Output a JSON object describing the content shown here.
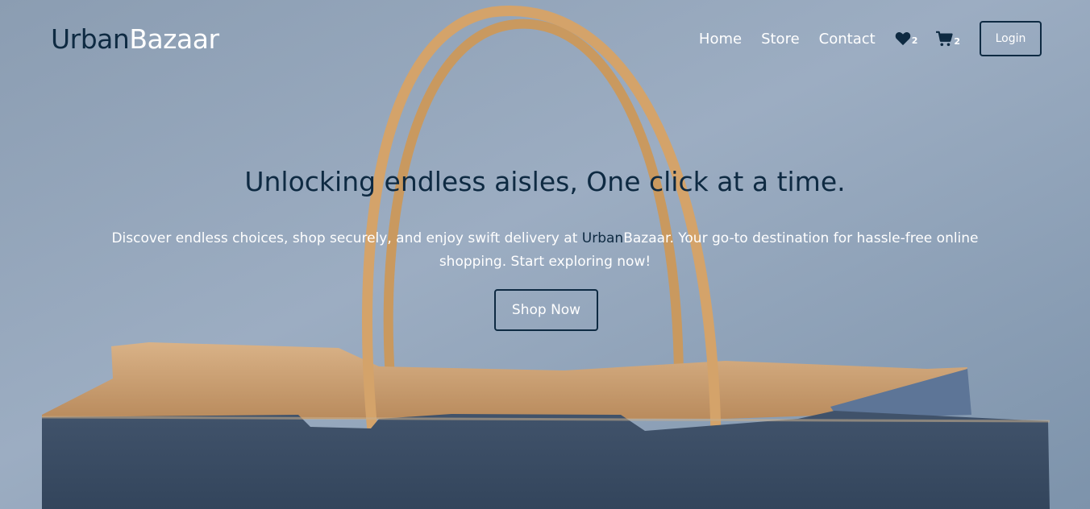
{
  "nav": {
    "brand_part1": "Urban",
    "brand_part2": "Bazaar",
    "links": [
      "Home",
      "Store",
      "Contact"
    ],
    "wishlist_icon": "heart-icon",
    "wishlist_count": "2",
    "cart_icon": "cart-icon",
    "cart_count": "2",
    "login_label": "Login"
  },
  "hero": {
    "title": "Unlocking endless aisles, One click at a time.",
    "desc_before": "Discover endless choices, shop securely, and enjoy swift delivery at ",
    "desc_brand_part1": "Urban",
    "desc_brand_part2": "Bazaar",
    "desc_after": ". Your go-to destination for hassle-free online shopping. Start exploring now!",
    "cta_label": "Shop Now"
  },
  "colors": {
    "navy": "#0e2a42",
    "white": "#ffffff",
    "background_sky": "#93a5b8",
    "bag_blue": "#3a4d66",
    "kraft": "#cfa574"
  }
}
